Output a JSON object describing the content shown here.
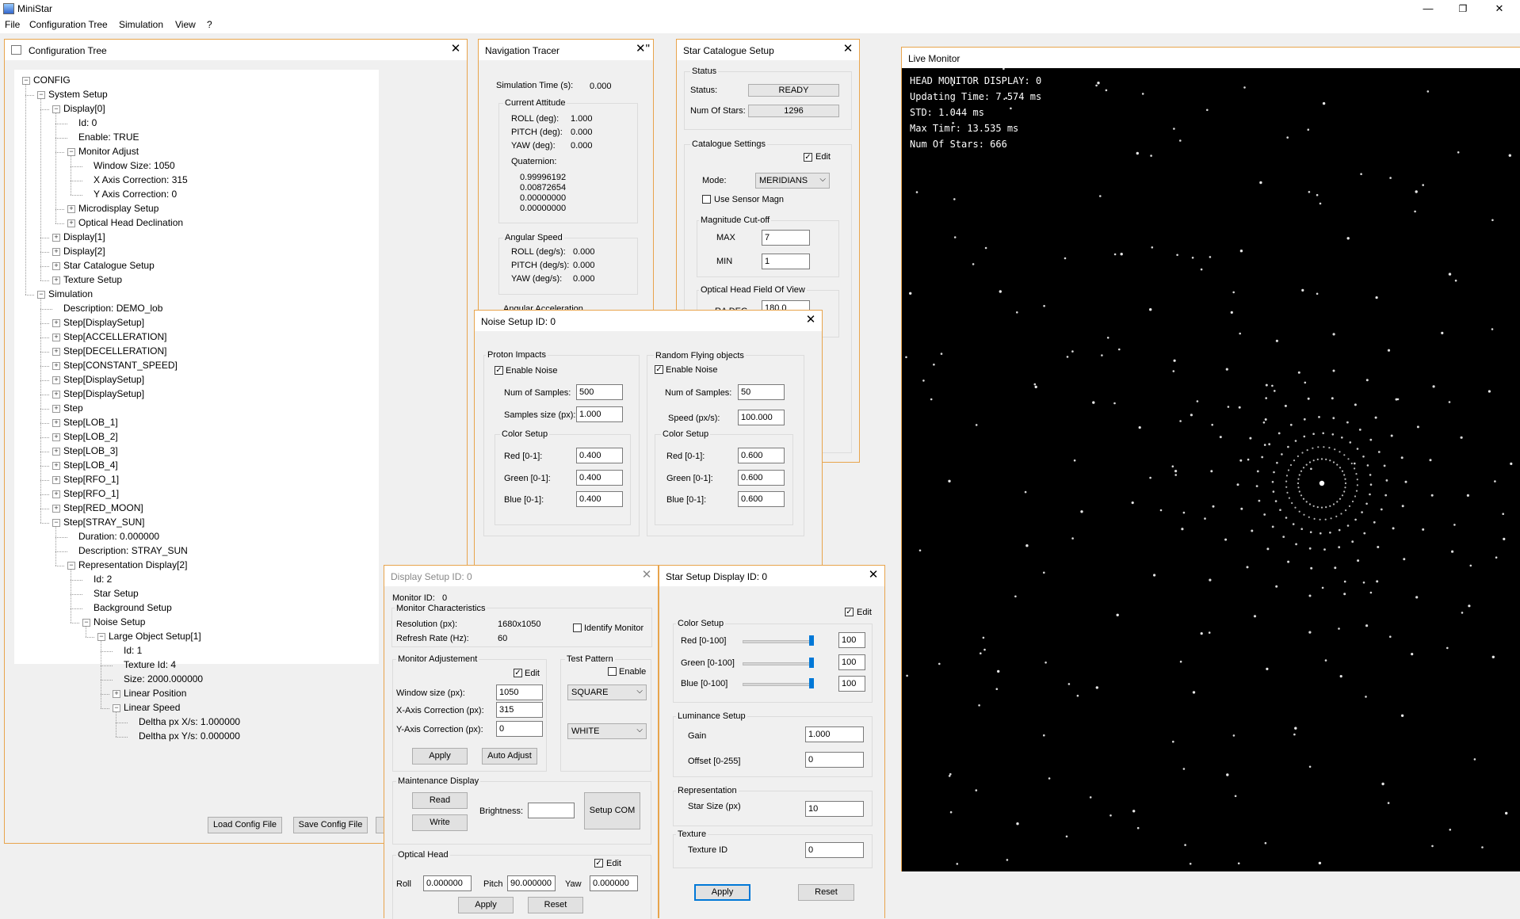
{
  "app": {
    "title": "MiniStar"
  },
  "window_controls": {
    "minimize": "—",
    "restore": "❐",
    "close": "✕"
  },
  "menu": [
    "File",
    "Configuration Tree",
    "Simulation",
    "View",
    "?"
  ],
  "config_tree": {
    "title": "Configuration Tree",
    "nodes": [
      {
        "label": "CONFIG",
        "level": 0,
        "exp": "-"
      },
      {
        "label": "System Setup",
        "level": 1,
        "exp": "-"
      },
      {
        "label": "Display[0]",
        "level": 2,
        "exp": "-"
      },
      {
        "label": "Id: 0",
        "level": 3,
        "exp": ""
      },
      {
        "label": "Enable: TRUE",
        "level": 3,
        "exp": ""
      },
      {
        "label": "Monitor Adjust",
        "level": 3,
        "exp": "-"
      },
      {
        "label": "Window Size: 1050",
        "level": 4,
        "exp": ""
      },
      {
        "label": "X Axis Correction: 315",
        "level": 4,
        "exp": ""
      },
      {
        "label": "Y Axis Correction: 0",
        "level": 4,
        "exp": ""
      },
      {
        "label": "Microdisplay Setup",
        "level": 3,
        "exp": "+"
      },
      {
        "label": "Optical Head Declination",
        "level": 3,
        "exp": "+"
      },
      {
        "label": "Display[1]",
        "level": 2,
        "exp": "+"
      },
      {
        "label": "Display[2]",
        "level": 2,
        "exp": "+"
      },
      {
        "label": "Star Catalogue Setup",
        "level": 2,
        "exp": "+"
      },
      {
        "label": "Texture Setup",
        "level": 2,
        "exp": "+"
      },
      {
        "label": "Simulation",
        "level": 1,
        "exp": "-"
      },
      {
        "label": "Description: DEMO_lob",
        "level": 2,
        "exp": ""
      },
      {
        "label": "Step[DisplaySetup]",
        "level": 2,
        "exp": "+"
      },
      {
        "label": "Step[ACCELLERATION]",
        "level": 2,
        "exp": "+"
      },
      {
        "label": "Step[DECELLERATION]",
        "level": 2,
        "exp": "+"
      },
      {
        "label": "Step[CONSTANT_SPEED]",
        "level": 2,
        "exp": "+"
      },
      {
        "label": "Step[DisplaySetup]",
        "level": 2,
        "exp": "+"
      },
      {
        "label": "Step[DisplaySetup]",
        "level": 2,
        "exp": "+"
      },
      {
        "label": "Step",
        "level": 2,
        "exp": "+"
      },
      {
        "label": "Step[LOB_1]",
        "level": 2,
        "exp": "+"
      },
      {
        "label": "Step[LOB_2]",
        "level": 2,
        "exp": "+"
      },
      {
        "label": "Step[LOB_3]",
        "level": 2,
        "exp": "+"
      },
      {
        "label": "Step[LOB_4]",
        "level": 2,
        "exp": "+"
      },
      {
        "label": "Step[RFO_1]",
        "level": 2,
        "exp": "+"
      },
      {
        "label": "Step[RFO_1]",
        "level": 2,
        "exp": "+"
      },
      {
        "label": "Step[RED_MOON]",
        "level": 2,
        "exp": "+"
      },
      {
        "label": "Step[STRAY_SUN]",
        "level": 2,
        "exp": "-"
      },
      {
        "label": "Duration: 0.000000",
        "level": 3,
        "exp": ""
      },
      {
        "label": "Description: STRAY_SUN",
        "level": 3,
        "exp": ""
      },
      {
        "label": "Representation Display[2]",
        "level": 3,
        "exp": "-"
      },
      {
        "label": "Id: 2",
        "level": 4,
        "exp": ""
      },
      {
        "label": "Star Setup",
        "level": 4,
        "exp": ""
      },
      {
        "label": "Background Setup",
        "level": 4,
        "exp": ""
      },
      {
        "label": "Noise Setup",
        "level": 4,
        "exp": "-"
      },
      {
        "label": "Large Object Setup[1]",
        "level": 5,
        "exp": "-"
      },
      {
        "label": "Id: 1",
        "level": 6,
        "exp": ""
      },
      {
        "label": "Texture Id: 4",
        "level": 6,
        "exp": ""
      },
      {
        "label": "Size: 2000.000000",
        "level": 6,
        "exp": ""
      },
      {
        "label": "Linear Position",
        "level": 6,
        "exp": "+"
      },
      {
        "label": "Linear Speed",
        "level": 6,
        "exp": "-"
      },
      {
        "label": "Deltha px X/s: 1.000000",
        "level": 7,
        "exp": ""
      },
      {
        "label": "Deltha px Y/s: 0.000000",
        "level": 7,
        "exp": ""
      }
    ],
    "load_button": "Load Config File",
    "save_button": "Save Config File"
  },
  "nav_tracer": {
    "title": "Navigation Tracer",
    "sim_time_label": "Simulation Time (s):",
    "sim_time_value": "0.000",
    "attitude_group": "Current Attitude",
    "roll_label": "ROLL (deg):",
    "roll_value": "1.000",
    "pitch_label": "PITCH (deg):",
    "pitch_value": "0.000",
    "yaw_label": "YAW (deg):",
    "yaw_value": "0.000",
    "quaternion_label": "Quaternion:",
    "quaternion": [
      "0.99996192",
      "0.00872654",
      "0.00000000",
      "0.00000000"
    ],
    "angular_group": "Angular Speed",
    "roll_speed_label": "ROLL (deg/s):",
    "roll_speed_value": "0.000",
    "pitch_speed_label": "PITCH (deg/s):",
    "pitch_speed_value": "0.000",
    "yaw_speed_label": "YAW (deg/s):",
    "yaw_speed_value": "0.000",
    "angular_accel_partial": "Angular Acceleration"
  },
  "star_catalogue": {
    "title": "Star Catalogue Setup",
    "status_group": "Status",
    "status_label": "Status:",
    "status_value": "READY",
    "num_stars_label": "Num Of Stars:",
    "num_stars_value": "1296",
    "settings_group": "Catalogue Settings",
    "edit_label": "Edit",
    "mode_label": "Mode:",
    "mode_value": "MERIDIANS",
    "use_sensor_magn": "Use Sensor Magn",
    "mag_group": "Magnitude Cut-off",
    "max_label": "MAX",
    "max_value": "7",
    "min_label": "MIN",
    "min_value": "1",
    "fov_group": "Optical Head Field Of View",
    "ra_label": "RA DEG",
    "ra_value": "180.0"
  },
  "noise_setup": {
    "title": "Noise Setup ID: 0",
    "proton_group": "Proton Impacts",
    "proton_enable": "Enable Noise",
    "proton_samples_label": "Num of Samples:",
    "proton_samples_value": "500",
    "proton_size_label": "Samples size (px):",
    "proton_size_value": "1.000",
    "proton_color_group": "Color Setup",
    "proton_red_label": "Red [0-1]:",
    "proton_red": "0.400",
    "proton_green_label": "Green [0-1]:",
    "proton_green": "0.400",
    "proton_blue_label": "Blue [0-1]:",
    "proton_blue": "0.400",
    "rfo_group": "Random Flying objects",
    "rfo_enable": "Enable Noise",
    "rfo_samples_label": "Num of Samples:",
    "rfo_samples_value": "50",
    "rfo_speed_label": "Speed (px/s):",
    "rfo_speed_value": "100.000",
    "rfo_color_group": "Color Setup",
    "rfo_red_label": "Red [0-1]:",
    "rfo_red": "0.600",
    "rfo_green_label": "Green [0-1]:",
    "rfo_green": "0.600",
    "rfo_blue_label": "Blue [0-1]:",
    "rfo_blue": "0.600"
  },
  "display_setup": {
    "title": "Display Setup ID: 0",
    "monitor_id_label": "Monitor ID:",
    "monitor_id_value": "0",
    "characteristics_group": "Monitor Characteristics",
    "resolution_label": "Resolution (px):",
    "resolution_value": "1680x1050",
    "refresh_label": "Refresh Rate (Hz):",
    "refresh_value": "60",
    "identify_monitor": "Identify Monitor",
    "adjustment_group": "Monitor Adjustement",
    "edit_label": "Edit",
    "window_size_label": "Window size (px):",
    "window_size_value": "1050",
    "x_corr_label": "X-Axis Correction (px):",
    "x_corr_value": "315",
    "y_corr_label": "Y-Axis Correction (px):",
    "y_corr_value": "0",
    "apply": "Apply",
    "auto_adjust": "Auto Adjust",
    "test_pattern_group": "Test Pattern",
    "enable": "Enable",
    "pattern_value": "SQUARE",
    "pattern_color_value": "WHITE",
    "maintenance_group": "Maintenance Display",
    "read": "Read",
    "write": "Write",
    "brightness_label": "Brightness:",
    "brightness_value": "",
    "setup_com": "Setup COM",
    "optical_group": "Optical Head",
    "optical_edit": "Edit",
    "roll_label": "Roll",
    "roll_value": "0.000000",
    "pitch_label": "Pitch",
    "pitch_value": "90.000000",
    "yaw_label": "Yaw",
    "yaw_value": "0.000000",
    "optical_apply": "Apply",
    "optical_reset": "Reset"
  },
  "star_setup": {
    "title": "Star Setup Display ID: 0",
    "edit_label": "Edit",
    "color_group": "Color Setup",
    "red_label": "Red   [0-100]",
    "red_value": "100",
    "red_level": 100,
    "green_label": "Green [0-100]",
    "green_value": "100",
    "green_level": 100,
    "blue_label": "Blue   [0-100]",
    "blue_value": "100",
    "blue_level": 100,
    "luminance_group": "Luminance Setup",
    "gain_label": "Gain",
    "gain_value": "1.000",
    "offset_label": "Offset [0-255]",
    "offset_value": "0",
    "representation_group": "Representation",
    "star_size_label": "Star Size (px)",
    "star_size_value": "10",
    "texture_group": "Texture",
    "texture_id_label": "Texture ID",
    "texture_id_value": "0",
    "apply": "Apply",
    "reset": "Reset"
  },
  "live_monitor": {
    "title": "Live Monitor",
    "lines": [
      "HEAD MONITOR DISPLAY: 0",
      "Updating Time: 7.574 ms",
      "STD: 1.044 ms",
      "Max Timr: 13.535 ms",
      "Num Of Stars: 666"
    ]
  },
  "colors": {
    "window_border": "#e8a44c",
    "accent": "#0078d7",
    "monitor_bg": "#000000",
    "star": "#ffffff"
  }
}
